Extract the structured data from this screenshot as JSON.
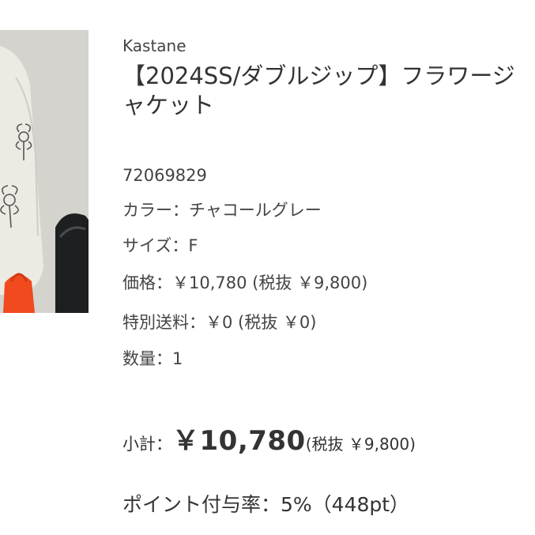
{
  "product": {
    "brand": "Kastane",
    "title": "【2024SS/ダブルジップ】フラワージャケット",
    "sku": "72069829",
    "color": "カラー：チャコールグレー",
    "size": "サイズ：F",
    "price": "価格：￥10,780 (税抜 ￥9,800)",
    "shipping": "特別送料：￥0 (税抜 ￥0)",
    "quantity": "数量：1"
  },
  "summary": {
    "subtotal_label": "小計：",
    "subtotal_price": "￥10,780",
    "subtotal_tax": "(税抜 ￥9,800)",
    "points": "ポイント付与率：5%（448pt）"
  }
}
